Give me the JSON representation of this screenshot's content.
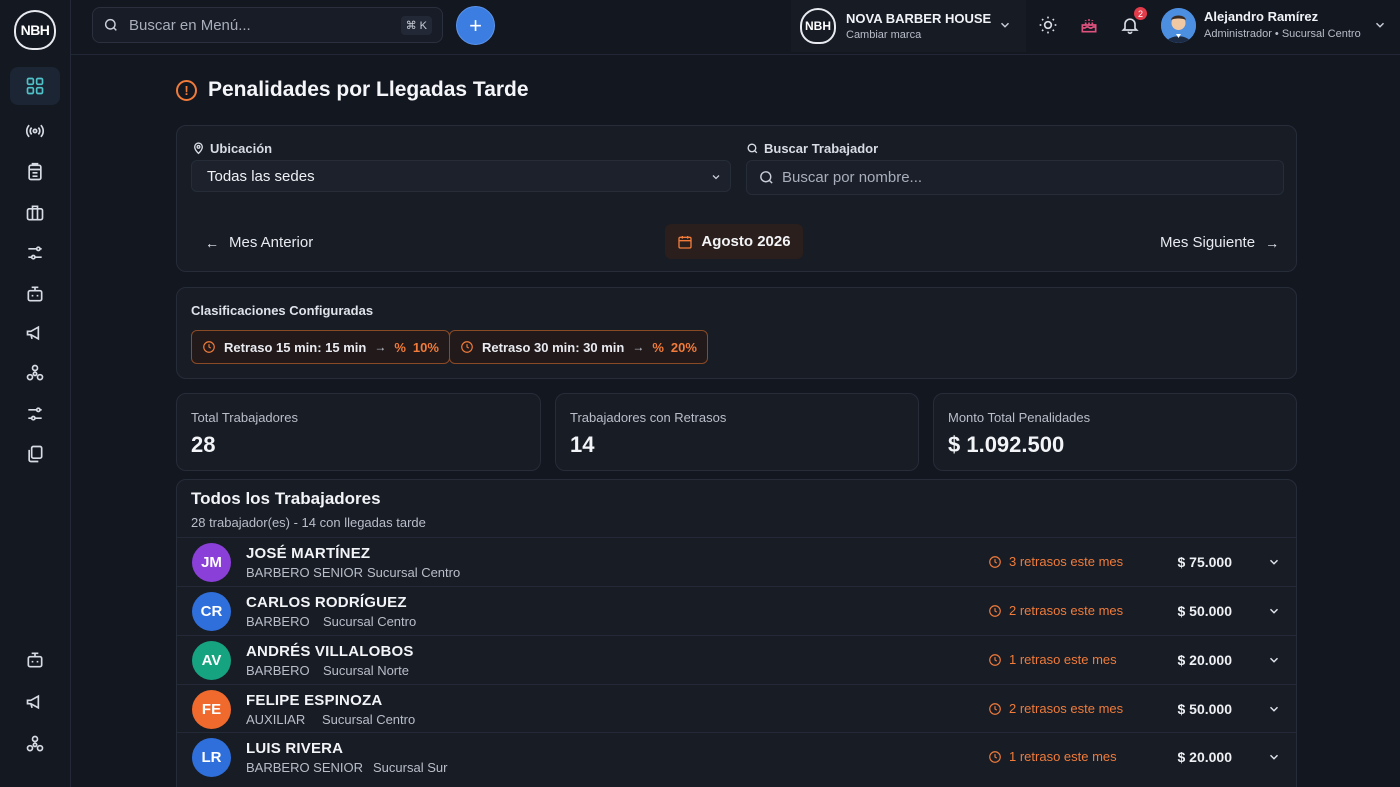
{
  "topbar": {
    "search_placeholder": "Buscar en Menú...",
    "shortcut": "⌘ K",
    "brand_logo": "NBH",
    "brand_name": "NOVA BARBER HOUSE",
    "brand_sub": "Cambiar marca",
    "notifications_count": "2",
    "user_name": "Alejandro Ramírez",
    "user_role": "Administrador  •  Sucursal Centro"
  },
  "sidebar": {
    "logo": "NBH",
    "icons": [
      "grid-icon",
      "broadcast-icon",
      "building-icon",
      "briefcase-icon",
      "sliders-icon",
      "robot-icon",
      "megaphone-icon",
      "network-icon",
      "sliders-icon",
      "layers-icon"
    ],
    "bottom_icons": [
      "robot-icon",
      "megaphone-icon",
      "network-icon"
    ]
  },
  "page": {
    "title": "Penalidades por Llegadas Tarde"
  },
  "filters": {
    "location_label": "Ubicación",
    "location_value": "Todas las sedes",
    "worker_label": "Buscar Trabajador",
    "worker_placeholder": "Buscar por nombre...",
    "prev_month": "Mes Anterior",
    "current_month": "Agosto 2026",
    "next_month": "Mes Siguiente"
  },
  "classifications": {
    "title": "Clasificaciones Configuradas",
    "items": [
      {
        "label": "Retraso 15 min: 15 min",
        "pct_symbol": "%",
        "value": "10%"
      },
      {
        "label": "Retraso 30 min: 30 min",
        "pct_symbol": "%",
        "value": "20%"
      }
    ]
  },
  "stats": [
    {
      "label": "Total Trabajadores",
      "value": "28"
    },
    {
      "label": "Trabajadores con Retrasos",
      "value": "14"
    },
    {
      "label": "Monto Total Penalidades",
      "value": "$ 1.092.500"
    }
  ],
  "workers": {
    "title": "Todos los Trabajadores",
    "subtitle": "28 trabajador(es) - 14 con llegadas tarde",
    "rows": [
      {
        "initials": "JM",
        "name": "JOSÉ MARTÍNEZ",
        "role": "BARBERO SENIOR",
        "branch": "Sucursal Centro",
        "late": "3 retrasos este mes",
        "amount": "$ 75.000",
        "color": "#8b3fd9"
      },
      {
        "initials": "CR",
        "name": "CARLOS RODRÍGUEZ",
        "role": "BARBERO",
        "branch": "Sucursal Centro",
        "late": "2 retrasos este mes",
        "amount": "$ 50.000",
        "color": "#2f6fdc"
      },
      {
        "initials": "AV",
        "name": "ANDRÉS VILLALOBOS",
        "role": "BARBERO",
        "branch": "Sucursal Norte",
        "late": "1 retraso este mes",
        "amount": "$ 20.000",
        "color": "#16a37f"
      },
      {
        "initials": "FE",
        "name": "FELIPE ESPINOZA",
        "role": "AUXILIAR",
        "branch": "Sucursal Centro",
        "late": "2 retrasos este mes",
        "amount": "$ 50.000",
        "color": "#ef6a2c"
      },
      {
        "initials": "LR",
        "name": "LUIS RIVERA",
        "role": "BARBERO SENIOR",
        "branch": "Sucursal Sur",
        "late": "1 retraso este mes",
        "amount": "$ 20.000",
        "color": "#2f6fdc"
      }
    ]
  },
  "colors": {
    "accent": "#3b7de0",
    "warning": "#f07b3a",
    "background": "#131720",
    "card": "#171c25"
  }
}
